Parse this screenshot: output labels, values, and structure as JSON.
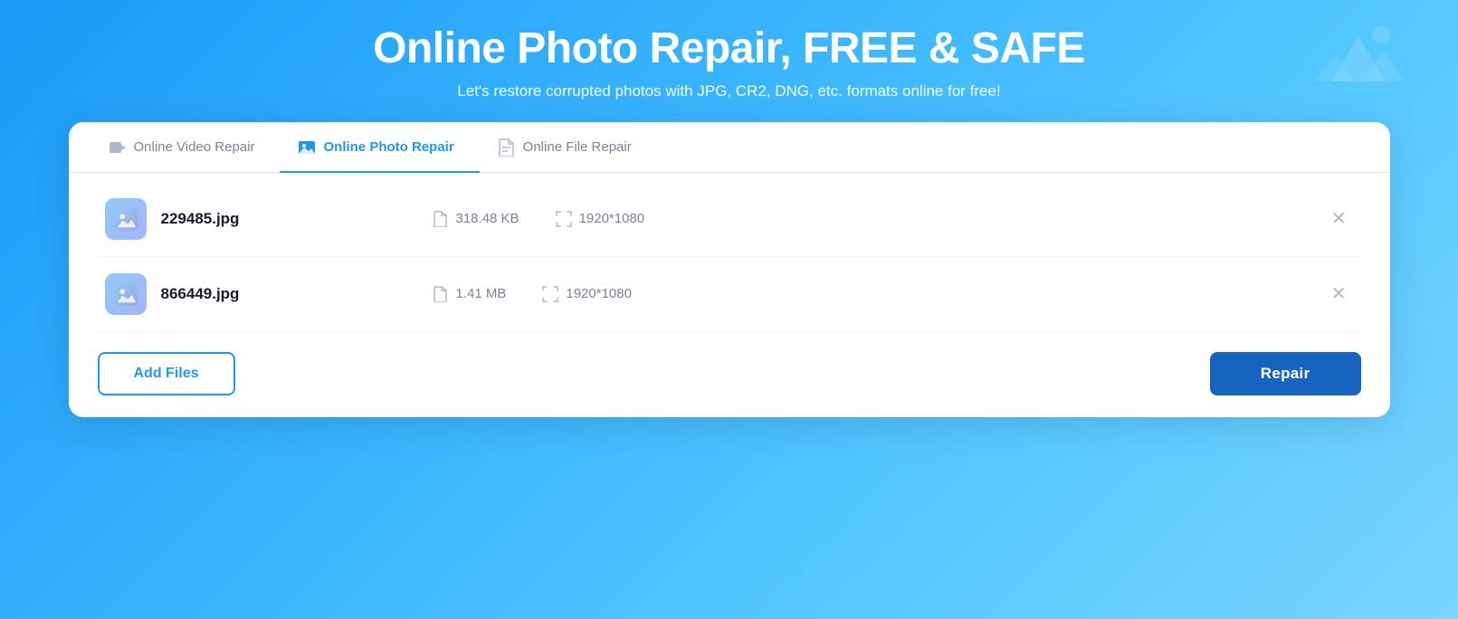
{
  "header": {
    "title": "Online Photo Repair, FREE & SAFE",
    "subtitle": "Let's restore corrupted photos with JPG, CR2, DNG, etc. formats online for free!"
  },
  "tabs": [
    {
      "id": "video",
      "label": "Online Video Repair",
      "active": false
    },
    {
      "id": "photo",
      "label": "Online Photo Repair",
      "active": true
    },
    {
      "id": "file",
      "label": "Online File Repair",
      "active": false
    }
  ],
  "files": [
    {
      "name": "229485.jpg",
      "size": "318.48 KB",
      "dimensions": "1920*1080"
    },
    {
      "name": "866449.jpg",
      "size": "1.41 MB",
      "dimensions": "1920*1080"
    }
  ],
  "buttons": {
    "add_files": "Add Files",
    "repair": "Repair"
  }
}
